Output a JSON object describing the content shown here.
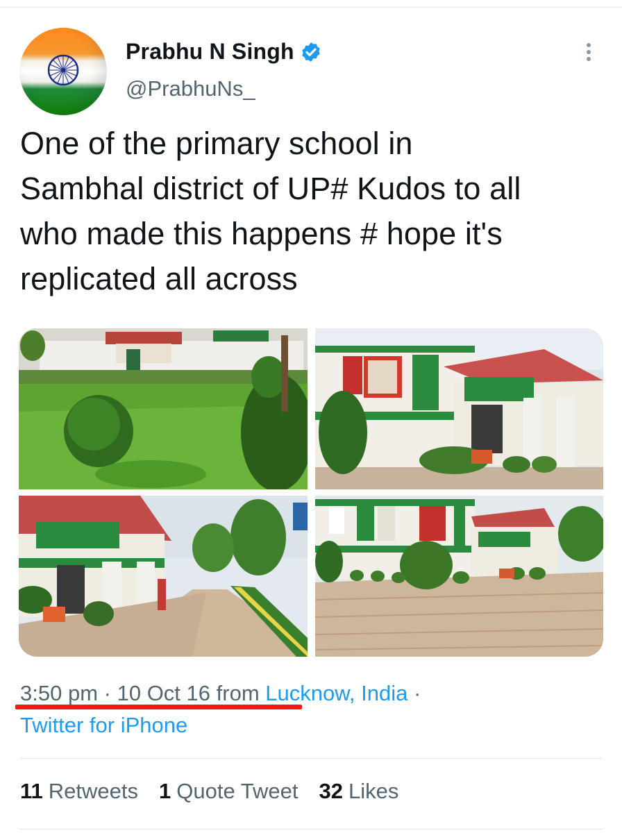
{
  "author": {
    "name": "Prabhu N Singh",
    "handle": "@PrabhuNs_",
    "verified_icon": "verified-badge-icon",
    "avatar_icon": "india-flag-avatar"
  },
  "tweet": {
    "text": "One of the primary school in\nSambhal district of UP# Kudos to all\nwho made this happens  # hope it's\nreplicated all across"
  },
  "media": {
    "photos": [
      {
        "alt": "school-lawn-garden"
      },
      {
        "alt": "school-building-front"
      },
      {
        "alt": "school-entrance-pathway"
      },
      {
        "alt": "school-courtyard-paving"
      }
    ]
  },
  "meta": {
    "time": "3:50 pm",
    "sep1": "·",
    "date": "10 Oct 16",
    "from": "from",
    "place": "Lucknow, India",
    "sep2": "·",
    "source": "Twitter for iPhone"
  },
  "stats": {
    "retweets_count": "11",
    "retweets_label": "Retweets",
    "quotes_count": "1",
    "quotes_label": "Quote Tweet",
    "likes_count": "32",
    "likes_label": "Likes"
  },
  "colors": {
    "link": "#1d9bf0",
    "secondary_text": "#536471",
    "underline_annotation": "#ef1b1b"
  }
}
